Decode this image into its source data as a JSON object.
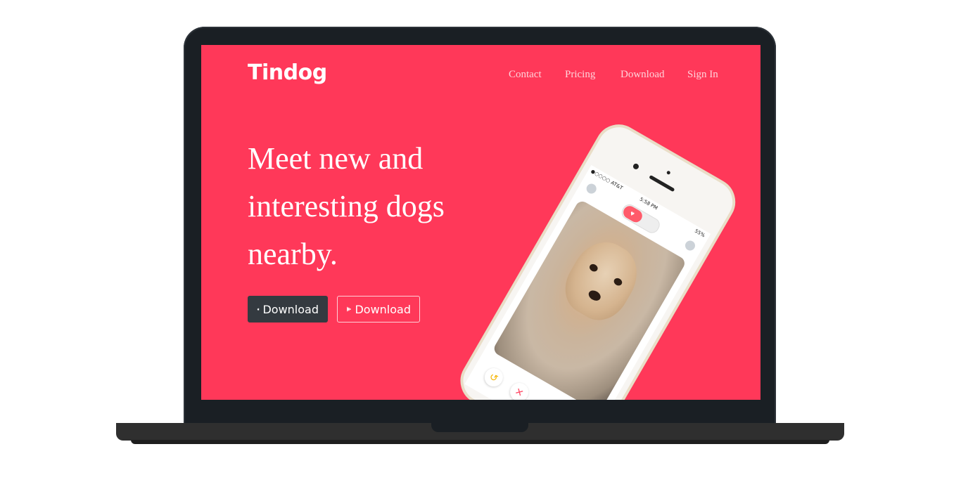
{
  "brand": "Tindog",
  "nav": {
    "links": [
      "Contact",
      "Pricing",
      "Download",
      "Sign In"
    ]
  },
  "hero": {
    "headline": "Meet new and interesting dogs nearby.",
    "buttons": [
      {
        "label": "Download",
        "icon": "apple-icon",
        "style": "dark"
      },
      {
        "label": "Download",
        "icon": "google-play-icon",
        "style": "outline"
      }
    ]
  },
  "phone": {
    "carrier": "●○○○○ AT&T",
    "time": "5:58 PM",
    "battery": "55%"
  },
  "colors": {
    "accent": "#ff3859",
    "dark_button": "#343a40",
    "laptop": "#1a1f24"
  }
}
